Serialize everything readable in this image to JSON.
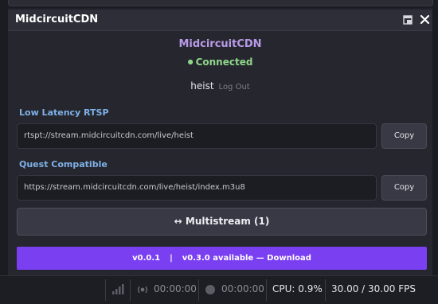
{
  "dock": {
    "title": "MidcircuitCDN",
    "icons": {
      "undock": "undock-icon",
      "close": "close-icon"
    }
  },
  "header": {
    "brand": "MidcircuitCDN",
    "status_dot": "●",
    "status": "Connected",
    "username": "heist",
    "logout_label": "Log Out"
  },
  "rtsp": {
    "label": "Low Latency RTSP",
    "url": "rtspt://stream.midcircuitcdn.com/live/heist",
    "copy_label": "Copy"
  },
  "quest": {
    "label": "Quest Compatible",
    "url": "https://stream.midcircuitcdn.com/live/heist/index.m3u8",
    "copy_label": "Copy"
  },
  "multistream_label": "↔ Multistream (1)",
  "update": {
    "current_version": "v0.0.1",
    "separator": "|",
    "available_text": "v0.3.0 available — Download"
  },
  "statusbar": {
    "stream_time": "00:00:00",
    "record_time": "00:00:00",
    "cpu": "CPU: 0.9%",
    "fps": "30.00 / 30.00 FPS"
  },
  "colors": {
    "brand": "#b99ae8",
    "connected": "#8fd78a",
    "section_label": "#7fb0e8",
    "update_bar": "#7b3ff2"
  }
}
